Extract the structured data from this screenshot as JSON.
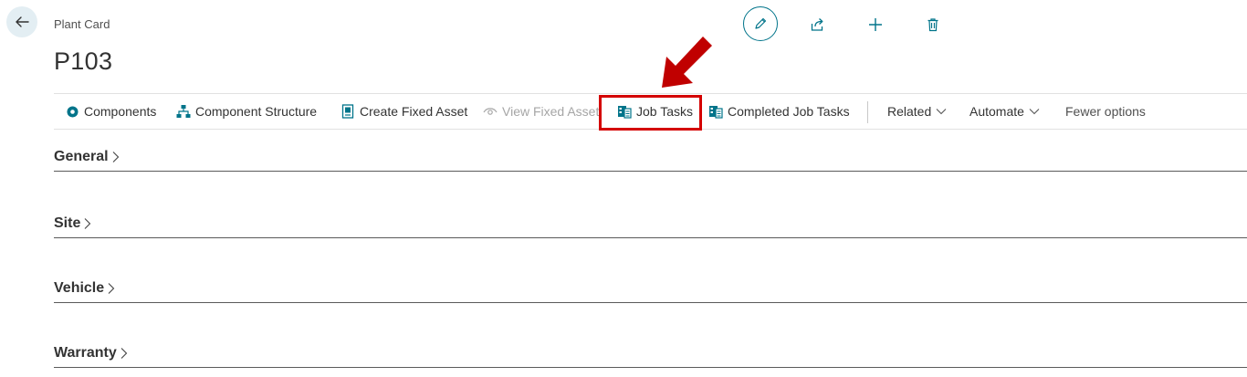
{
  "page": {
    "caption": "Plant Card",
    "title": "P103"
  },
  "top_actions": [
    "edit-icon",
    "share-icon",
    "plus-icon",
    "delete-icon"
  ],
  "actionbar": {
    "components": "Components",
    "component_structure": "Component Structure",
    "create_fixed_asset": "Create Fixed Asset",
    "view_fixed_asset": "View Fixed Asset",
    "job_tasks": "Job Tasks",
    "completed_job_tasks": "Completed Job Tasks",
    "related": "Related",
    "automate": "Automate",
    "fewer_options": "Fewer options"
  },
  "sections": {
    "general": "General",
    "site": "Site",
    "vehicle": "Vehicle",
    "warranty": "Warranty"
  },
  "colors": {
    "accent": "#00748a",
    "highlight": "#d40000",
    "arrow": "#c00000",
    "back_bg": "#e3eef3"
  }
}
